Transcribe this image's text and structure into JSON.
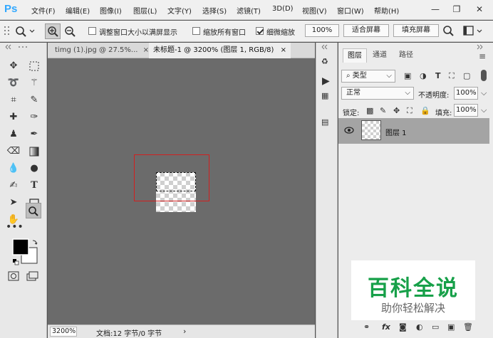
{
  "app": {
    "logo": "Ps"
  },
  "menu": [
    "文件(F)",
    "编辑(E)",
    "图像(I)",
    "图层(L)",
    "文字(Y)",
    "选择(S)",
    "滤镜(T)",
    "3D(D)",
    "视图(V)",
    "窗口(W)",
    "帮助(H)"
  ],
  "window_controls": {
    "minimize": "—",
    "restore": "❐",
    "close": "✕"
  },
  "options": {
    "resize_windows_label": "调整窗口大小以满屏显示",
    "zoom_all_label": "缩放所有窗口",
    "scrubby_zoom_label": "细微缩放",
    "zoom_percent": "100%",
    "fit_screen_label": "适合屏幕",
    "fill_screen_label": "填充屏幕"
  },
  "tabs": [
    {
      "label": "timg (1).jpg @ 27.5%...",
      "close": "×"
    },
    {
      "label": "未标题-1 @ 3200% (图层 1, RGB/8)",
      "close": "×"
    }
  ],
  "status": {
    "zoom": "3200%",
    "doc_info": "文档:12 字节/0 字节",
    "arrow": "›"
  },
  "layers_panel": {
    "tabs": [
      "图层",
      "通道",
      "路径"
    ],
    "filter_kind": "类型",
    "blend_mode": "正常",
    "opacity_label": "不透明度:",
    "opacity_value": "100%",
    "lock_label": "锁定:",
    "fill_label": "填充:",
    "fill_value": "100%",
    "layer_name": "图层 1"
  },
  "watermark": {
    "title": "百科全说",
    "subtitle": "助你轻松解决"
  }
}
